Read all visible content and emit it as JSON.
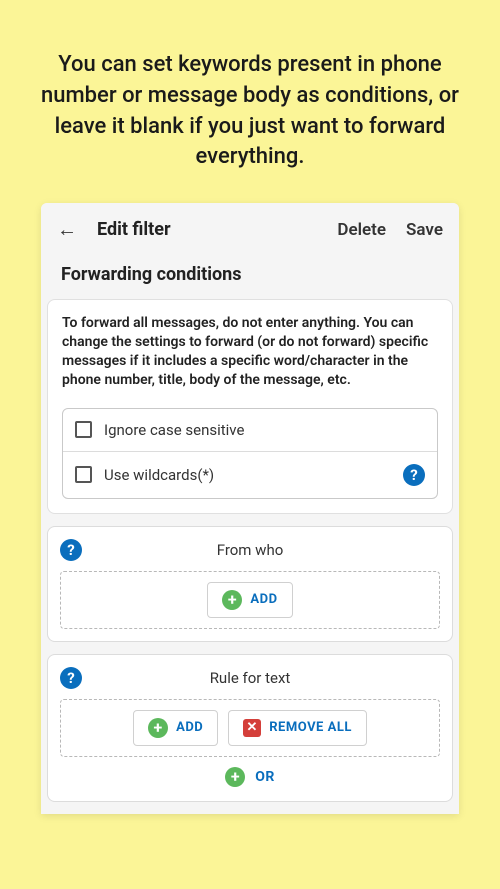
{
  "promo": "You can set keywords present in phone number or message body as conditions, or leave it blank if you just want to forward everything.",
  "appbar": {
    "title": "Edit filter",
    "delete": "Delete",
    "save": "Save"
  },
  "section_title": "Forwarding conditions",
  "info_text": "To forward all messages, do not enter anything. You can change the settings to forward (or do not forward) specific messages if it includes a specific word/character in the phone number, title, body of the message, etc.",
  "checkboxes": {
    "ignore_case": "Ignore case sensitive",
    "wildcards": "Use wildcards(*)"
  },
  "from_who": {
    "title": "From who",
    "add": "ADD"
  },
  "rule_text": {
    "title": "Rule for text",
    "add": "ADD",
    "remove_all": "REMOVE ALL",
    "or": "OR"
  }
}
